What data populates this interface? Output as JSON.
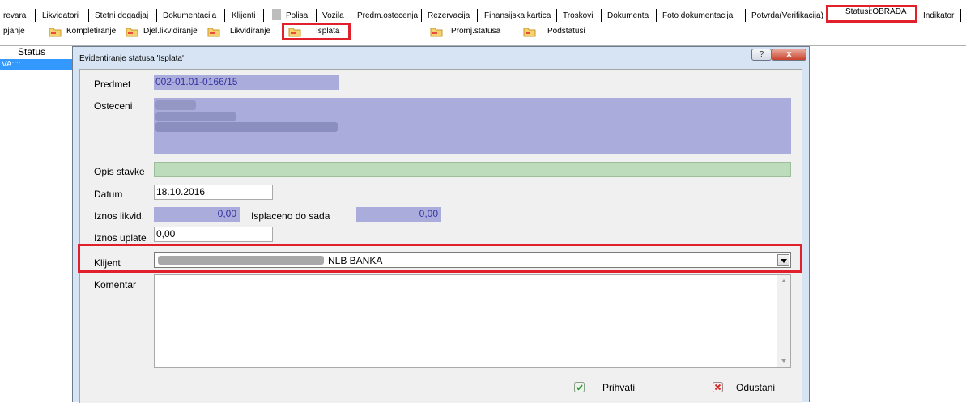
{
  "tabs": [
    {
      "label": "revara"
    },
    {
      "label": "Likvidatori"
    },
    {
      "label": "Stetni dogadjaj"
    },
    {
      "label": "Dokumentacija"
    },
    {
      "label": "Klijenti"
    },
    {
      "label": "Polisa"
    },
    {
      "label": "Vozila"
    },
    {
      "label": "Predm.ostecenja"
    },
    {
      "label": "Rezervacija"
    },
    {
      "label": "Finansijska kartica"
    },
    {
      "label": "Troskovi"
    },
    {
      "label": "Dokumenta"
    },
    {
      "label": "Foto dokumentacija"
    },
    {
      "label": "Potvrda(Verifikacija)"
    },
    {
      "label": "Statusi:OBRADA"
    },
    {
      "label": "Indikatori"
    }
  ],
  "toolbar": [
    {
      "label": "pjanje"
    },
    {
      "label": "Kompletiranje"
    },
    {
      "label": "Djel.likvidiranje"
    },
    {
      "label": "Likvidiranje"
    },
    {
      "label": "Isplata"
    },
    {
      "label": "Promj.statusa"
    },
    {
      "label": "Podstatusi"
    }
  ],
  "grid": {
    "status_header": "Status",
    "status_cell": "VA::::"
  },
  "dialog": {
    "title": "Evidentiranje statusa 'Isplata'",
    "help_label": "?",
    "close_label": "x",
    "fields": {
      "predmet": {
        "label": "Predmet",
        "value": "002-01.01-0166/15"
      },
      "osteceni": {
        "label": "Osteceni"
      },
      "opis_stavke": {
        "label": "Opis stavke",
        "value": ""
      },
      "datum": {
        "label": "Datum",
        "value": "18.10.2016"
      },
      "iznos_likvid": {
        "label": "Iznos likvid.",
        "value": "0,00"
      },
      "isplaceno": {
        "label": "Isplaceno do sada",
        "value": "0,00"
      },
      "iznos_uplate": {
        "label": "Iznos uplate",
        "value": "0,00"
      },
      "klijent": {
        "label": "Klijent",
        "value": "NLB BANKA"
      },
      "komentar": {
        "label": "Komentar",
        "value": ""
      }
    },
    "buttons": {
      "accept": "Prihvati",
      "cancel": "Odustani"
    }
  },
  "colors": {
    "highlight": "#e0202a",
    "readonly": "#aaaddb",
    "selection": "#3399ff"
  }
}
